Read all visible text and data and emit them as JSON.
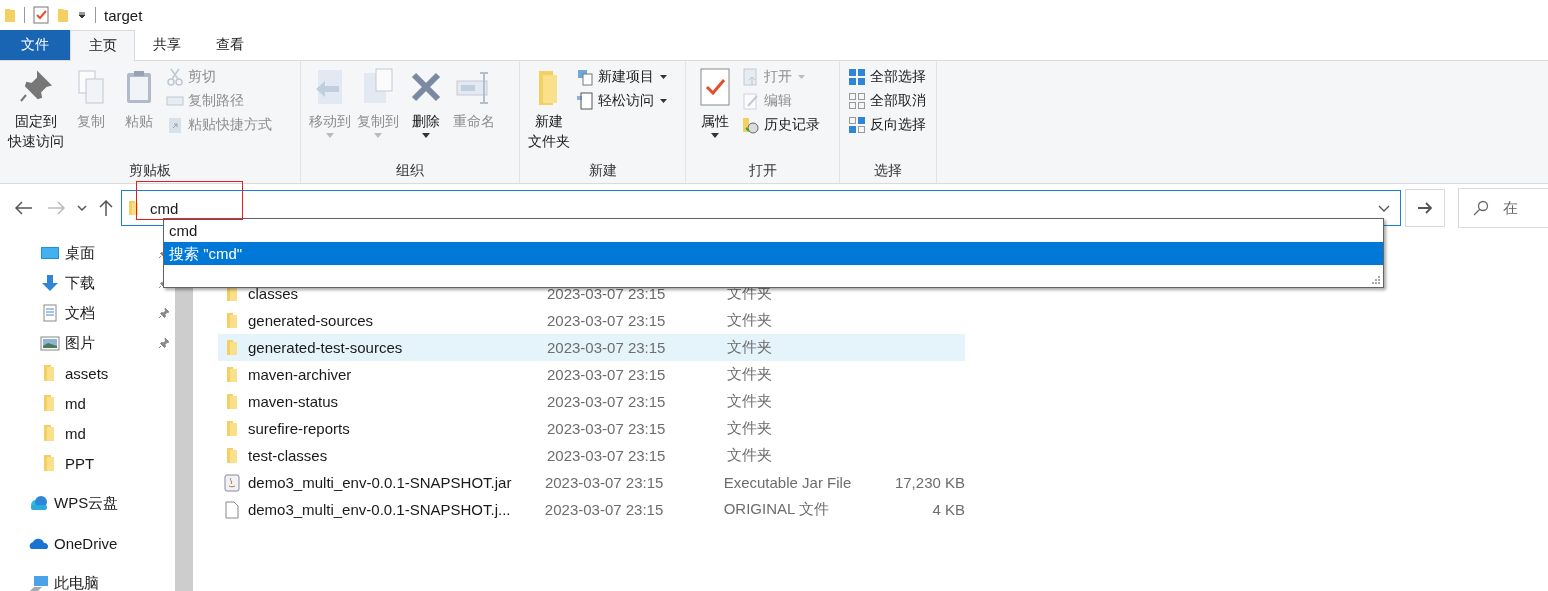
{
  "title_bar": {
    "title": "target"
  },
  "ribbon_tabs": [
    {
      "label": "文件",
      "kind": "file",
      "selected": false
    },
    {
      "label": "主页",
      "kind": "tab",
      "selected": true
    },
    {
      "label": "共享",
      "kind": "tab",
      "selected": false
    },
    {
      "label": "查看",
      "kind": "tab",
      "selected": false
    }
  ],
  "ribbon_groups": [
    {
      "label": "剪贴板",
      "items": [
        {
          "lines": [
            "固定到",
            "快速访问"
          ],
          "kind": "large",
          "disabled": false,
          "dropdown": false
        },
        {
          "lines": [
            "复制"
          ],
          "kind": "large",
          "disabled": true,
          "dropdown": false
        },
        {
          "lines": [
            "粘贴"
          ],
          "kind": "large",
          "disabled": true,
          "dropdown": false
        },
        {
          "label": "剪切",
          "kind": "small",
          "disabled": true,
          "dropdown": false
        },
        {
          "label": "复制路径",
          "kind": "small",
          "disabled": true,
          "dropdown": false
        },
        {
          "label": "粘贴快捷方式",
          "kind": "small",
          "disabled": true,
          "dropdown": false
        }
      ]
    },
    {
      "label": "组织",
      "items": [
        {
          "lines": [
            "移动到"
          ],
          "kind": "large",
          "disabled": true,
          "dropdown": true
        },
        {
          "lines": [
            "复制到"
          ],
          "kind": "large",
          "disabled": true,
          "dropdown": true
        },
        {
          "lines": [
            "删除"
          ],
          "kind": "large",
          "disabled": false,
          "dropdown": true
        },
        {
          "lines": [
            "重命名"
          ],
          "kind": "large",
          "disabled": true,
          "dropdown": false
        }
      ]
    },
    {
      "label": "新建",
      "items": [
        {
          "lines": [
            "新建",
            "文件夹"
          ],
          "kind": "large",
          "disabled": false,
          "dropdown": false
        },
        {
          "label": "新建项目",
          "kind": "small",
          "disabled": false,
          "dropdown": true
        },
        {
          "label": "轻松访问",
          "kind": "small",
          "disabled": false,
          "dropdown": true
        }
      ]
    },
    {
      "label": "打开",
      "items": [
        {
          "lines": [
            "属性"
          ],
          "kind": "large",
          "disabled": false,
          "dropdown": true
        },
        {
          "label": "打开",
          "kind": "small",
          "disabled": true,
          "dropdown": true
        },
        {
          "label": "编辑",
          "kind": "small",
          "disabled": true,
          "dropdown": false
        },
        {
          "label": "历史记录",
          "kind": "small",
          "disabled": false,
          "dropdown": false
        }
      ]
    },
    {
      "label": "选择",
      "items": [
        {
          "label": "全部选择",
          "kind": "small",
          "disabled": false,
          "dropdown": false
        },
        {
          "label": "全部取消",
          "kind": "small",
          "disabled": false,
          "dropdown": false
        },
        {
          "label": "反向选择",
          "kind": "small",
          "disabled": false,
          "dropdown": false
        }
      ]
    }
  ],
  "navigation": {
    "back_disabled": false,
    "forward_disabled": true
  },
  "address_bar": {
    "value": "cmd"
  },
  "autocomplete": [
    {
      "label": "cmd",
      "selected": false
    },
    {
      "label": "搜索 \"cmd\"",
      "selected": true
    }
  ],
  "search": {
    "placeholder": "在"
  },
  "sidebar": {
    "items": [
      {
        "label": "桌面",
        "kind": "desktop",
        "pinned": true
      },
      {
        "label": "下载",
        "kind": "download",
        "pinned": true
      },
      {
        "label": "文档",
        "kind": "document",
        "pinned": true
      },
      {
        "label": "图片",
        "kind": "pictures",
        "pinned": true
      },
      {
        "label": "assets",
        "kind": "folder",
        "pinned": false
      },
      {
        "label": "md",
        "kind": "folder",
        "pinned": false
      },
      {
        "label": "md",
        "kind": "folder",
        "pinned": false
      },
      {
        "label": "PPT",
        "kind": "folder",
        "pinned": false
      },
      {
        "label": "WPS云盘",
        "kind": "wps",
        "pinned": false
      },
      {
        "label": "OneDrive",
        "kind": "onedrive",
        "pinned": false
      },
      {
        "label": "此电脑",
        "kind": "pc",
        "pinned": false
      }
    ]
  },
  "files": [
    {
      "name": "classes",
      "date": "2023-03-07 23:15",
      "type": "文件夹",
      "kind": "folder",
      "selected": false
    },
    {
      "name": "generated-sources",
      "date": "2023-03-07 23:15",
      "type": "文件夹",
      "kind": "folder",
      "selected": false
    },
    {
      "name": "generated-test-sources",
      "date": "2023-03-07 23:15",
      "type": "文件夹",
      "kind": "folder",
      "selected": true
    },
    {
      "name": "maven-archiver",
      "date": "2023-03-07 23:15",
      "type": "文件夹",
      "kind": "folder",
      "selected": false
    },
    {
      "name": "maven-status",
      "date": "2023-03-07 23:15",
      "type": "文件夹",
      "kind": "folder",
      "selected": false
    },
    {
      "name": "surefire-reports",
      "date": "2023-03-07 23:15",
      "type": "文件夹",
      "kind": "folder",
      "selected": false
    },
    {
      "name": "test-classes",
      "date": "2023-03-07 23:15",
      "type": "文件夹",
      "kind": "folder",
      "selected": false
    },
    {
      "name": "demo3_multi_env-0.0.1-SNAPSHOT.jar",
      "date": "2023-03-07 23:15",
      "type": "Executable Jar File",
      "size": "17,230 KB",
      "kind": "jar",
      "selected": false
    },
    {
      "name": "demo3_multi_env-0.0.1-SNAPSHOT.j...",
      "date": "2023-03-07 23:15",
      "type": "ORIGINAL 文件",
      "size": "4 KB",
      "kind": "file",
      "selected": false
    }
  ]
}
